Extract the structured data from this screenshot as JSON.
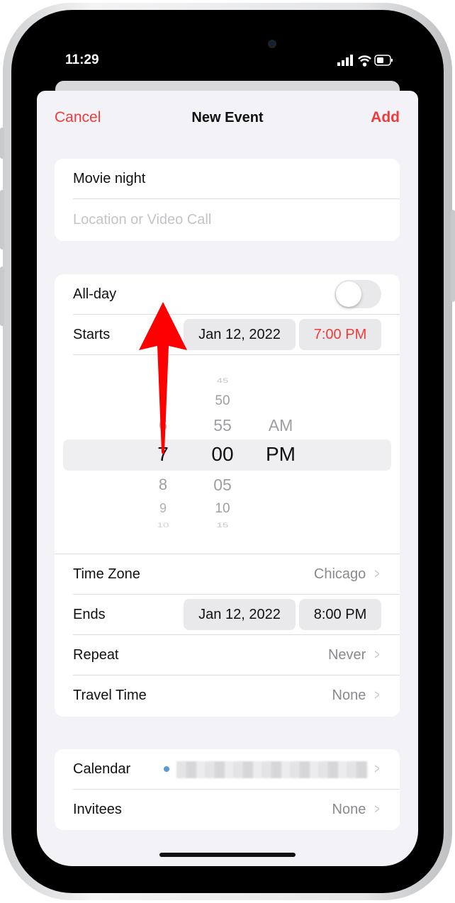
{
  "status_bar": {
    "time": "11:29",
    "icons": [
      "signal-icon",
      "wifi-icon",
      "battery-icon"
    ]
  },
  "header": {
    "cancel": "Cancel",
    "title": "New Event",
    "add": "Add"
  },
  "event": {
    "title": "Movie night",
    "location_placeholder": "Location or Video Call"
  },
  "all_day": {
    "label": "All-day",
    "on": false
  },
  "starts": {
    "label": "Starts",
    "date": "Jan 12, 2022",
    "time": "7:00 PM"
  },
  "picker": {
    "hours": [
      "6",
      "7",
      "8",
      "9",
      "10"
    ],
    "minutes": [
      "45",
      "50",
      "55",
      "00",
      "05",
      "10",
      "15"
    ],
    "ampm": [
      "AM",
      "PM"
    ],
    "selected": {
      "hour": "7",
      "minute": "00",
      "ampm": "PM"
    }
  },
  "time_zone": {
    "label": "Time Zone",
    "value": "Chicago"
  },
  "ends": {
    "label": "Ends",
    "date": "Jan 12, 2022",
    "time": "8:00 PM"
  },
  "repeat": {
    "label": "Repeat",
    "value": "Never"
  },
  "travel_time": {
    "label": "Travel Time",
    "value": "None"
  },
  "calendar": {
    "label": "Calendar",
    "dot_color": "#5b9bd5"
  },
  "invitees": {
    "label": "Invitees",
    "value": "None"
  },
  "colors": {
    "accent": "#ef3b3b",
    "annotation_arrow": "#ff0000"
  }
}
